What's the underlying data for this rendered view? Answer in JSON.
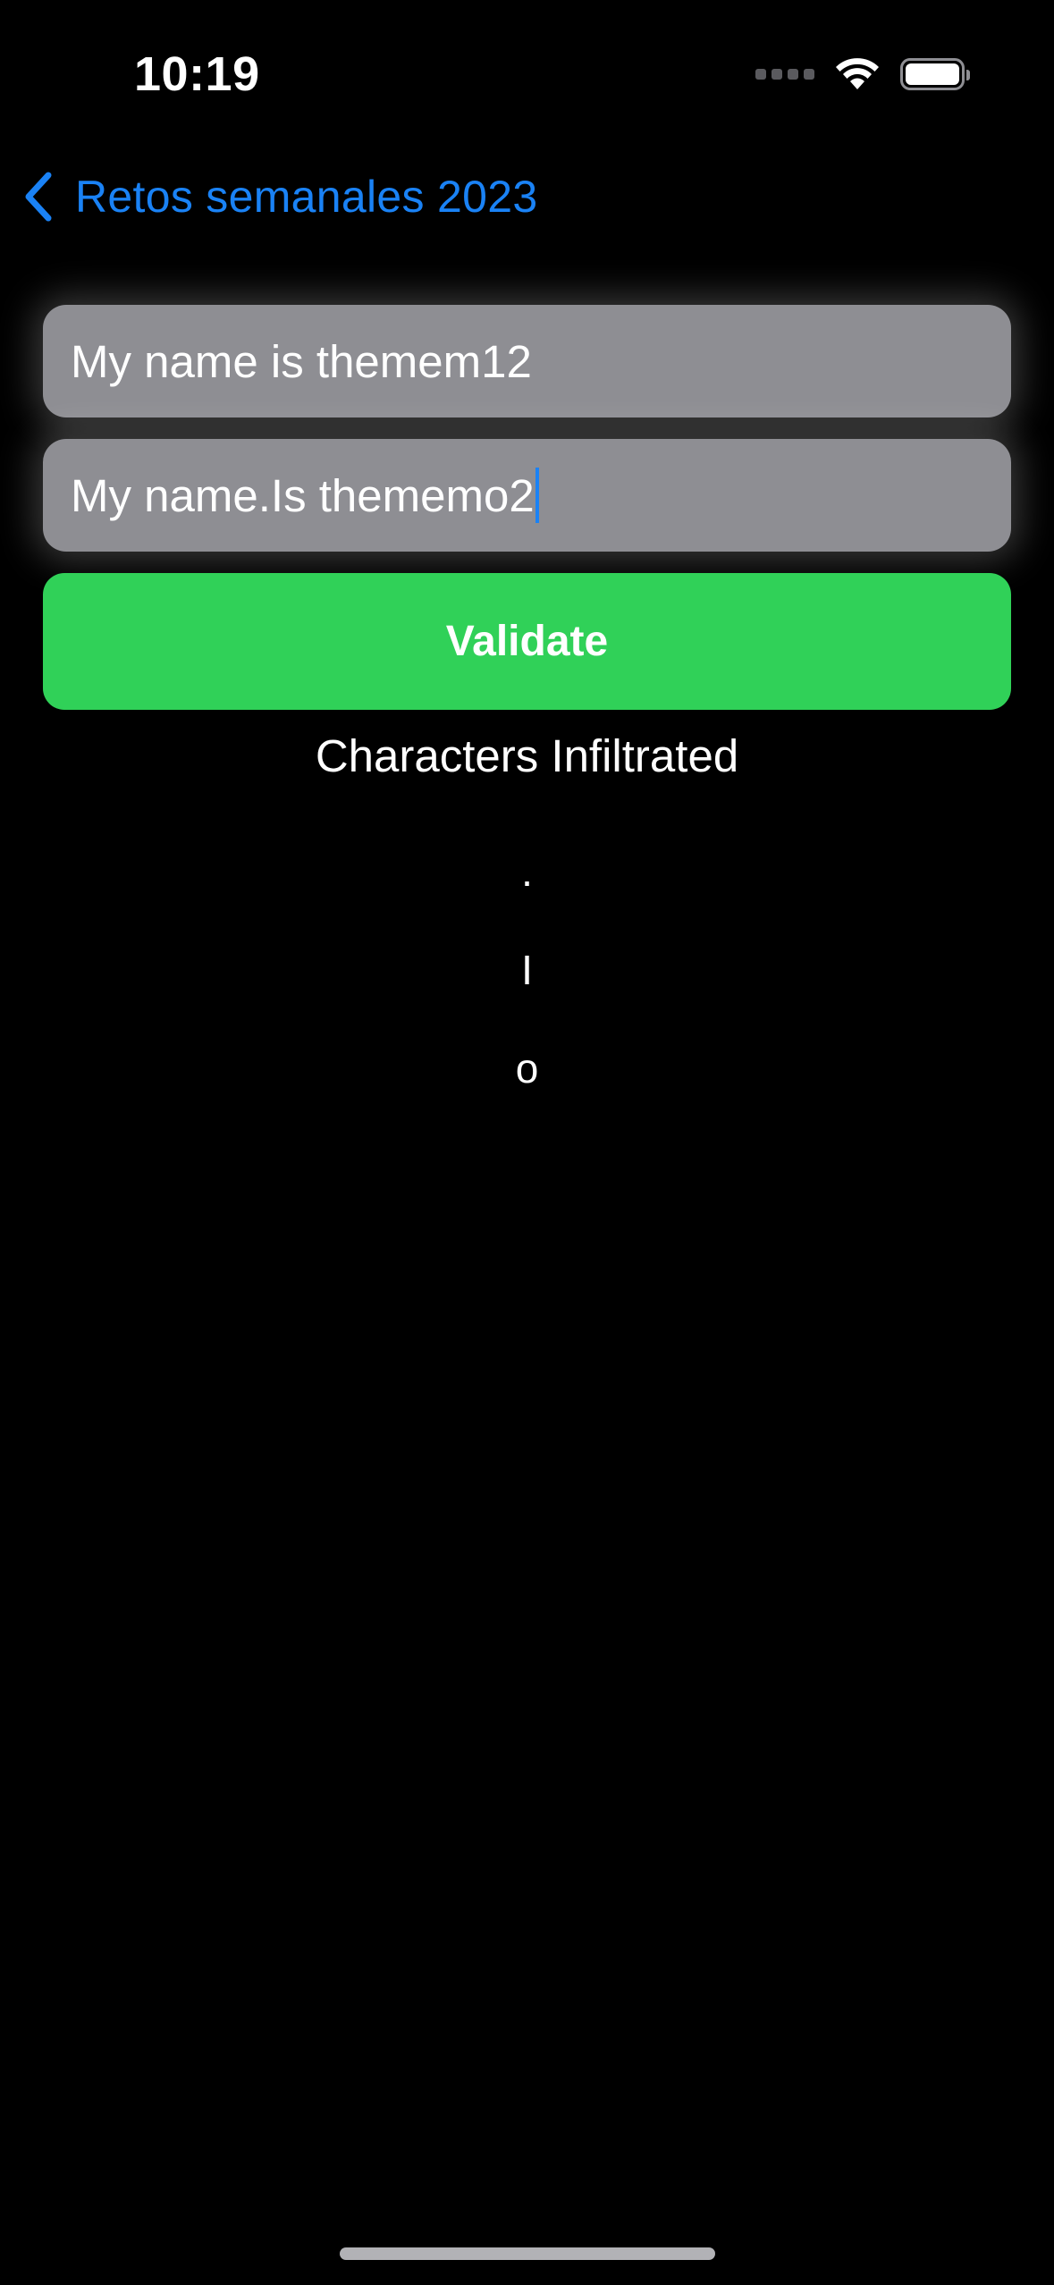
{
  "status_bar": {
    "time": "10:19",
    "icons": [
      "cellular-signal-icon",
      "wifi-icon",
      "battery-icon"
    ]
  },
  "nav": {
    "back_label": "Retos semanales 2023",
    "back_icon": "chevron-left-icon",
    "accent_color": "#1a82f5"
  },
  "form": {
    "field_1_value": "My name is themem12",
    "field_2_value": "My name.Is thememo2",
    "validate_label": "Validate",
    "button_color": "#30d158"
  },
  "result": {
    "title": "Characters Infiltrated",
    "characters": [
      ".",
      "I",
      "o"
    ]
  }
}
